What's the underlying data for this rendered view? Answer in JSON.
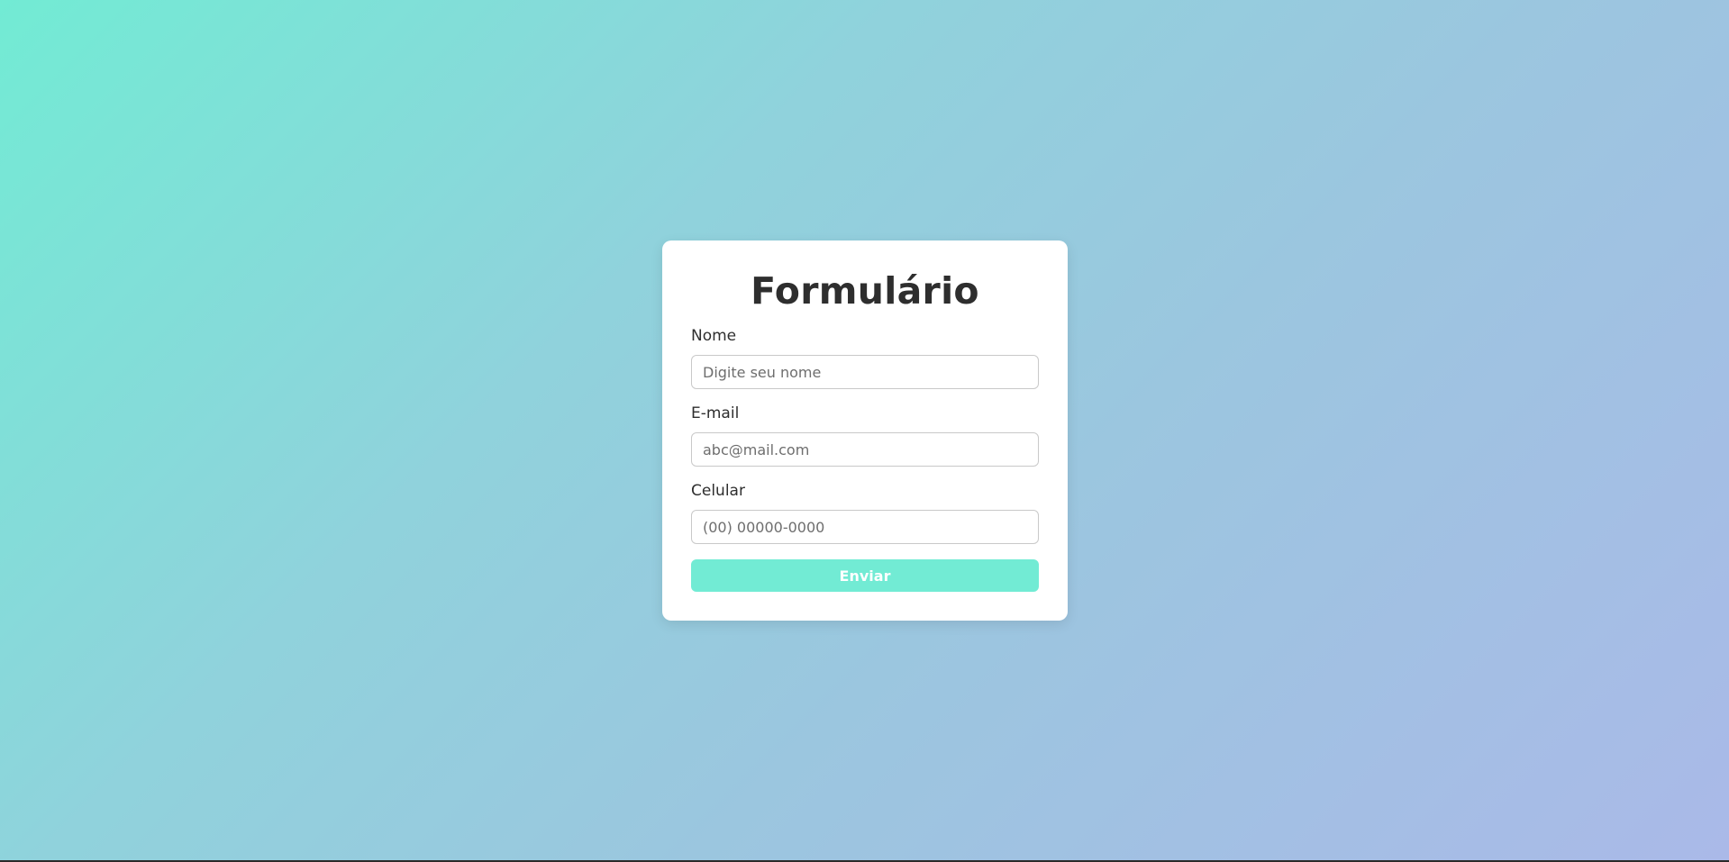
{
  "form": {
    "title": "Formulário",
    "fields": {
      "name": {
        "label": "Nome",
        "placeholder": "Digite seu nome",
        "value": ""
      },
      "email": {
        "label": "E-mail",
        "placeholder": "abc@mail.com",
        "value": ""
      },
      "phone": {
        "label": "Celular",
        "placeholder": "(00) 00000-0000",
        "value": ""
      }
    },
    "submit_label": "Enviar"
  },
  "colors": {
    "accent": "#72ebd4",
    "card_background": "#ffffff",
    "text": "#2e2e2e",
    "gradient_start": "#72ebd4",
    "gradient_end": "#aab9e8"
  }
}
